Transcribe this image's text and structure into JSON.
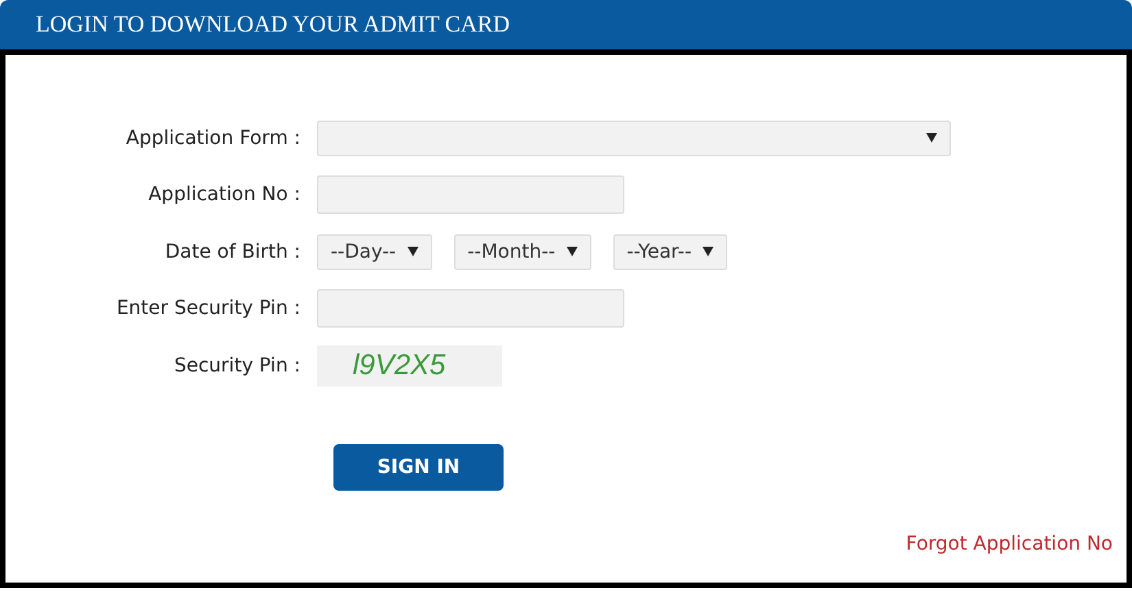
{
  "header": {
    "title": "LOGIN TO DOWNLOAD YOUR ADMIT CARD"
  },
  "fields": [
    {
      "label": "Application Form :",
      "kind": "select-wide"
    },
    {
      "label": "Application No :",
      "kind": "input"
    },
    {
      "label": "Date of Birth :",
      "kind": "date",
      "selects": [
        "--Day--",
        "--Month--",
        "--Year--"
      ]
    },
    {
      "label": "Enter Security Pin :",
      "kind": "input"
    },
    {
      "label": "Security Pin :",
      "kind": "captcha",
      "captcha": "l9V2X5"
    }
  ],
  "sign_in_button": "SIGN IN",
  "forgot_link": "Forgot Application No"
}
